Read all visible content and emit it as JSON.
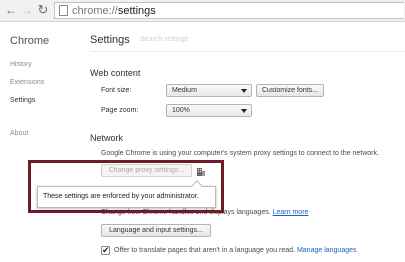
{
  "toolbar": {
    "url_scheme": "chrome://",
    "url_path": "settings",
    "back_icon": "arrow-left-icon",
    "forward_icon": "arrow-right-icon",
    "reload_icon": "reload-icon"
  },
  "sidebar": {
    "title": "Chrome",
    "items": [
      {
        "label": "History"
      },
      {
        "label": "Extensions"
      },
      {
        "label": "Settings"
      },
      {
        "label": "About"
      }
    ]
  },
  "main": {
    "title": "Settings",
    "search_placeholder": "Search settings",
    "web_content": {
      "heading": "Web content",
      "font_size_label": "Font size:",
      "font_size_value": "Medium",
      "customize_fonts_label": "Customize fonts...",
      "page_zoom_label": "Page zoom:",
      "page_zoom_value": "100%"
    },
    "network": {
      "heading": "Network",
      "description": "Google Chrome is using your computer's system proxy settings to connect to the network.",
      "change_proxy_label": "Change proxy settings..."
    },
    "tooltip": {
      "text": "These settings are enforced by your administrator."
    },
    "languages": {
      "description": "Change how Chrome handles and displays languages.",
      "learn_more": "Learn more",
      "language_input_label": "Language and input settings...",
      "translate_label": "Offer to translate pages that aren't in a language you read.",
      "manage_languages": "Manage languages",
      "translate_checked": true
    }
  }
}
